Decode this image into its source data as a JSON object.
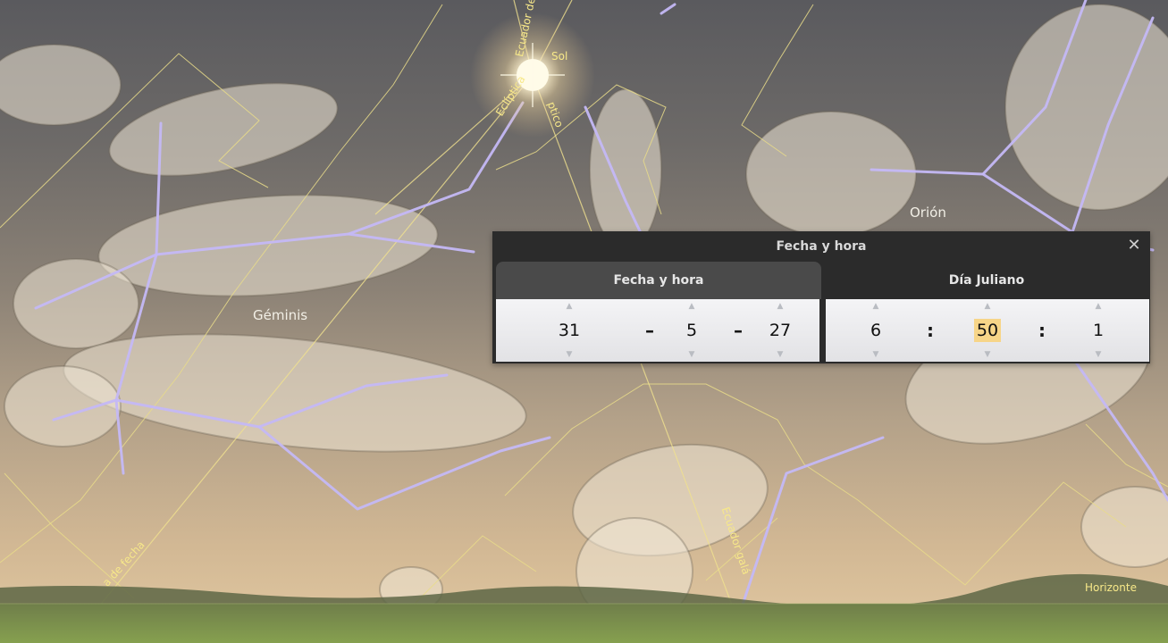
{
  "sky": {
    "constellations": [
      "Géminis",
      "Orión"
    ],
    "lines": {
      "ecuador_fecha_top": "Ecuador de fecha",
      "sol": "Sol",
      "ecliptica": "Eclíptica",
      "eclip_tail": "ptico",
      "ecuador_fecha_bottom": "a de fecha",
      "ecuador_galactico": "Ecuador galá",
      "horizonte": "Horizonte"
    },
    "colors": {
      "constellation_line": "#b8acf2",
      "boundary_line": "#e9dc8a",
      "sun": "#fffbe8",
      "ground": "#7b9148"
    }
  },
  "dialog": {
    "title": "Fecha y hora",
    "close": "✕",
    "tabs": {
      "date": "Fecha y hora",
      "julian": "Día Juliano"
    },
    "date": {
      "day": "31",
      "month": "5",
      "year": "27",
      "sep": "–"
    },
    "time": {
      "hour": "6",
      "minute": "50",
      "second": "1",
      "sep": ":"
    },
    "arrows": {
      "up": "▲",
      "down": "▼"
    }
  }
}
